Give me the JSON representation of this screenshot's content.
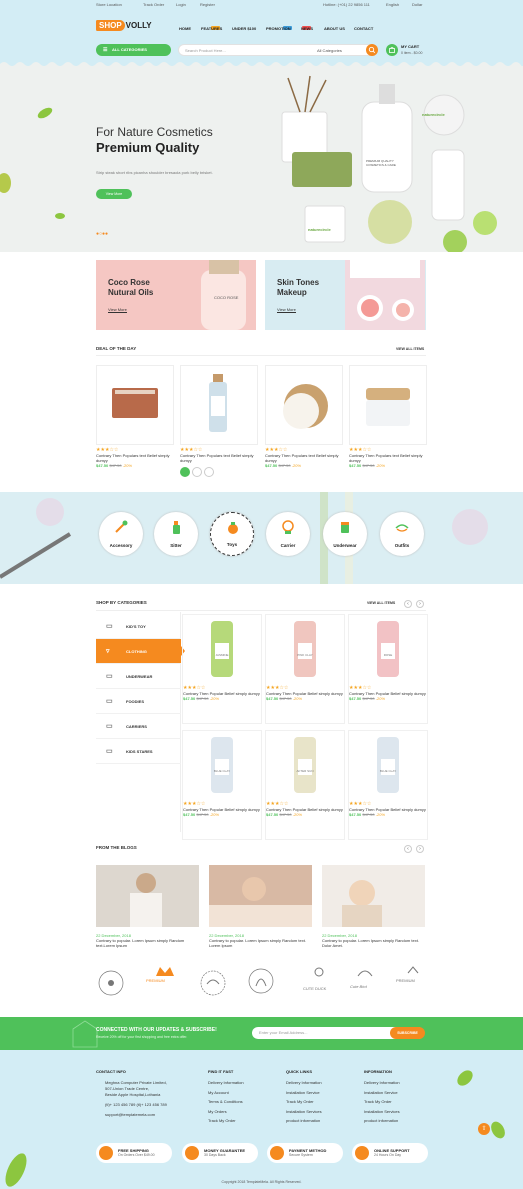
{
  "topbar": {
    "store": "Store Location",
    "track": "Track Order",
    "login": "Login",
    "register": "Register",
    "hotline": "Hotline: (+01) 22 9856 111",
    "lang": "English",
    "currency": "Dollar"
  },
  "logo": {
    "part1": "SHOP",
    "part2": "VOLLY"
  },
  "nav": [
    {
      "label": "HOME"
    },
    {
      "label": "FEATURES",
      "badge": "HOT",
      "badge_color": "#f5a623"
    },
    {
      "label": "UNDER $100"
    },
    {
      "label": "PROMOTION",
      "badge": "NEW",
      "badge_color": "#3b9bd9"
    },
    {
      "label": "NEWS",
      "badge": "HOT",
      "badge_color": "#ef5050"
    },
    {
      "label": "ABOUT US"
    },
    {
      "label": "CONTACT"
    }
  ],
  "search": {
    "all_categories_button": "ALL CATEGORIES",
    "placeholder": "Search Product Here...",
    "category": "All Categories"
  },
  "cart": {
    "title": "MY CART",
    "summary": "0 item - $0.00"
  },
  "hero": {
    "title1": "For Nature Cosmetics",
    "title2": "Premium Quality",
    "sub": "Strip steak short ribs picanha shoulder bresaola pork belly brisket.",
    "button": "View More",
    "product_text": "naturecircle",
    "product_text2": "PREMIUM QUALITY COSMETICS & CARE",
    "jar_text": "naturecircle"
  },
  "promos": [
    {
      "title": "Coco Rose Nutural Oils",
      "link": "View More",
      "bottle_text": "COCO ROSE"
    },
    {
      "title": "Skin Tones Makeup",
      "link": "View More"
    }
  ],
  "deal": {
    "title": "DEAL OF THE DAY",
    "view_all": "VIEW ALL ITEMS"
  },
  "products": [
    {
      "name": "Contrary Then Populars text Belief simply dumyy",
      "price": "$47.50",
      "old": "$47.50",
      "disc": "-20%"
    },
    {
      "name": "Contrary Then Populars text Belief simply dumyy",
      "price": "$47.50",
      "old": "$47.50",
      "disc": "-20%"
    },
    {
      "name": "Contrary Then Populars text Belief simply dumyy",
      "price": "$47.50",
      "old": "$47.50",
      "disc": "-20%"
    },
    {
      "name": "Contrary Then Populars text Belief simply dumyy",
      "price": "$47.50",
      "old": "$47.50",
      "disc": "-20%"
    }
  ],
  "circles": [
    {
      "label": "Accessory"
    },
    {
      "label": "Sitter"
    },
    {
      "label": "Toys"
    },
    {
      "label": "Carrier"
    },
    {
      "label": "Underwear"
    },
    {
      "label": "Outfits"
    }
  ],
  "shopcat": {
    "title": "SHOP BY CATEGORIES",
    "view_all": "VIEW ALL ITEMS",
    "items": [
      "KID'S TOY",
      "CLOTHING",
      "UNDERWEAR",
      "FOODIES",
      "CARRIERS",
      "KIDS STARES"
    ]
  },
  "grid": [
    {
      "name": "Contrary Then Popular Belief simply dumyy",
      "price": "$47.50",
      "old": "$47.50",
      "disc": "-20%"
    },
    {
      "name": "Contrary Then Popular Belief simply dumyy",
      "price": "$47.50",
      "old": "$47.50",
      "disc": "-20%"
    },
    {
      "name": "Contrary Then Popular Belief simply dumyy",
      "price": "$47.50",
      "old": "$47.50",
      "disc": "-20%"
    },
    {
      "name": "Contrary Then Popular Belief simply dumyy",
      "price": "$47.50",
      "old": "$47.50",
      "disc": "-20%"
    },
    {
      "name": "Contrary Then Popular Belief simply dumyy",
      "price": "$47.50",
      "old": "$47.50",
      "disc": "-20%"
    },
    {
      "name": "Contrary Then Popular Belief simply dumyy",
      "price": "$47.50",
      "old": "$47.50",
      "disc": "-20%"
    }
  ],
  "grid_labels": [
    "JASMINE",
    "PINK CLAY",
    "ROSE",
    "BLUE CLAY",
    "AFTER SUN",
    "BLUE CLAY"
  ],
  "blogs": {
    "title": "FROM THE BLOGS",
    "items": [
      {
        "date": "22 December, 2018",
        "text": "Contrary to popular. Lorem Ipsum simply Random text.Lorem Ipsum"
      },
      {
        "date": "22 December, 2018",
        "text": "Contrary to popular. Lorem Ipsum simply Random text. Lorem Ipsum"
      },
      {
        "date": "22 December, 2018",
        "text": "Contrary to popular. Lorem Ipsum simply Random text. Dolor Amet."
      }
    ]
  },
  "brands": [
    "",
    "PREMIUM",
    "",
    "",
    "CUTE DUCK",
    "Cute Bird",
    "PREMIUM"
  ],
  "newsletter": {
    "title": "CONNECTED WITH OUR UPDATES & SUBSCRIBE!",
    "sub": "Receive 20% off for your first shopping and free extra offer.",
    "placeholder": "Enter your Email Address...",
    "button": "SUBSCRIBE"
  },
  "footer": {
    "contact": {
      "title": "CONTACT INFO",
      "lines": [
        "Meghna Computer Private Limited,",
        "507-Union Trade Centre,",
        "Beside Apple Hospital,Lothania",
        "(tl)+ 123 456 789    (tl)+ 123 456 789",
        "support@templatemela.com"
      ]
    },
    "find": {
      "title": "FIND IT FAST",
      "items": [
        "Delivery Information",
        "My Account",
        "Terms & Conditions",
        "My Orders",
        "Track My Order"
      ]
    },
    "quick": {
      "title": "QUICK LINKS",
      "items": [
        "Delivery Information",
        "Installation Service",
        "Track My Order",
        "Installation Services",
        "product information"
      ]
    },
    "info": {
      "title": "INFORMATION",
      "items": [
        "Delivery Information",
        "Installation Service",
        "Track My Order",
        "Installation Services",
        "product information"
      ]
    },
    "features": [
      {
        "a": "FREE SHIPPING",
        "b": "On Orders Over $49.00"
      },
      {
        "a": "MONEY GUARANTEE",
        "b": "30 Days Back"
      },
      {
        "a": "PAYMENT METHOD",
        "b": "Secure System"
      },
      {
        "a": "ONLINE SUPPORT",
        "b": "24 Hours On Day"
      }
    ],
    "copyright": "Copyright 2018 TemplateMela. All Rights Reserved."
  },
  "colors": {
    "green": "#4fc15a",
    "orange": "#f58a1f",
    "sky": "#d3edf5"
  }
}
